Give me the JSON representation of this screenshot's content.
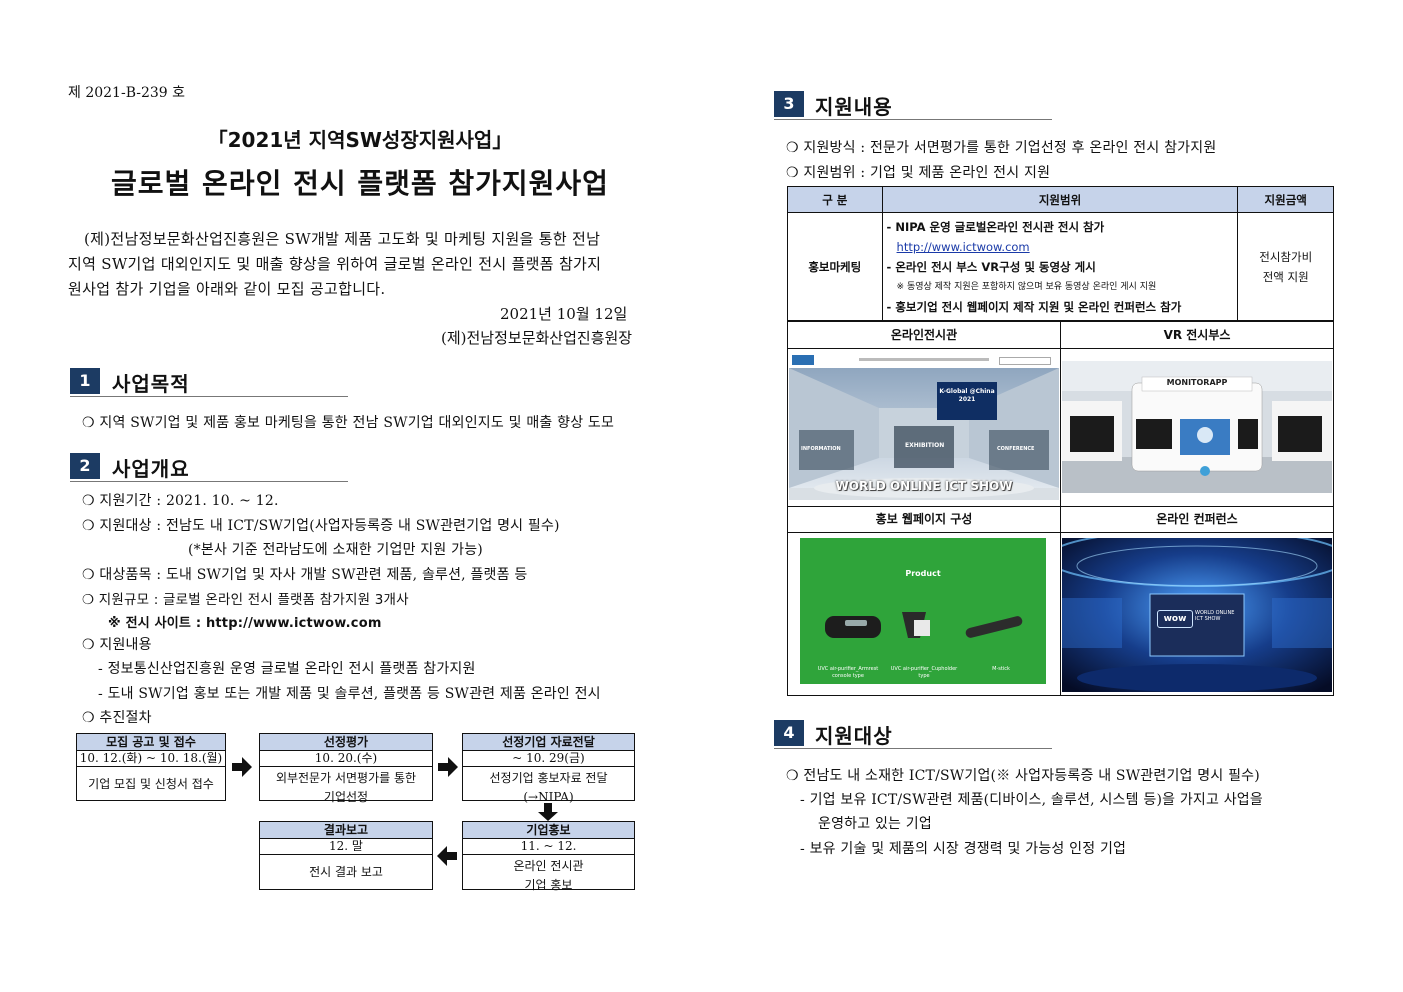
{
  "doc_number": "제  2021-B-239 호",
  "title_line1": "「2021년 지역SW성장지원사업」",
  "title_line2": "글로벌 온라인 전시 플랫폼 참가지원사업",
  "intro": [
    "(제)전남정보문화산업진흥원은 SW개발 제품 고도화 및 마케팅 지원을 통한 전남",
    "지역 SW기업 대외인지도 및 매출 향상을 위하여 글로벌 온라인 전시 플랫폼 참가지",
    "원사업 참가 기업을 아래와 같이 모집 공고합니다."
  ],
  "date": "2021년  10월  12일",
  "issuer": "(제)전남정보문화산업진흥원장",
  "sections": {
    "s1": {
      "num": "1",
      "title": "사업목적",
      "items": [
        "❍ 지역 SW기업 및 제품 홍보 마케팅을 통한 전남 SW기업 대외인지도 및 매출 향상 도모"
      ]
    },
    "s2": {
      "num": "2",
      "title": "사업개요",
      "items": [
        "❍ 지원기간 : 2021. 10. ~ 12.",
        "❍ 지원대상 : 전남도 내 ICT/SW기업(사업자등록증 내 SW관련기업 명시 필수)",
        "(*본사 기준 전라남도에 소재한 기업만 지원 가능)",
        "❍ 대상품목 : 도내 SW기업 및 자사 개발 SW관련 제품, 솔루션, 플랫폼 등",
        "❍ 지원규모 : 글로벌 온라인 전시 플랫폼 참가지원 3개사",
        "※ 전시 사이트 : http://www.ictwow.com",
        "❍ 지원내용",
        "- 정보통신산업진흥원 운영 글로벌 온라인 전시 플랫폼 참가지원",
        "- 도내 SW기업 홍보 또는 개발 제품 및 솔루션, 플랫폼 등 SW관련 제품 온라인 전시",
        "❍ 추진절차"
      ]
    },
    "s3": {
      "num": "3",
      "title": "지원내용",
      "items": [
        "❍ 지원방식 : 전문가 서면평가를 통한 기업선정 후 온라인 전시 참가지원",
        "❍ 지원범위 : 기업 및 제품 온라인 전시 지원"
      ]
    },
    "s4": {
      "num": "4",
      "title": "지원대상",
      "items": [
        "❍ 전남도 내 소재한 ICT/SW기업(※ 사업자등록증 내 SW관련기업 명시 필수)",
        "- 기업 보유 ICT/SW관련 제품(디바이스, 솔루션, 시스템 등)을 가지고 사업을",
        "운영하고 있는 기업",
        "- 보유 기술 및 제품의 시장 경쟁력 및 가능성 인정 기업"
      ]
    }
  },
  "flow": [
    {
      "head": "모집 공고 및 접수",
      "date": "10. 12.(화) ~ 10. 18.(월)",
      "body": [
        "기업 모집 및 신청서 접수"
      ]
    },
    {
      "head": "선정평가",
      "date": "10. 20.(수)",
      "body": [
        "외부전문가 서면평가를 통한",
        "기업선정"
      ]
    },
    {
      "head": "선정기업 자료전달",
      "date": "~ 10. 29(금)",
      "body": [
        "선정기업 홍보자료 전달",
        "(→NIPA)"
      ]
    },
    {
      "head": "기업홍보",
      "date": "11. ~ 12.",
      "body": [
        "온라인 전시관",
        "기업 홍보"
      ]
    },
    {
      "head": "결과보고",
      "date": "12. 말",
      "body": [
        "전시 결과 보고"
      ]
    }
  ],
  "table": {
    "headers": [
      "구  분",
      "지원범위",
      "지원금액"
    ],
    "row_label": "홍보마케팅",
    "scope": [
      "- NIPA 운영 글로벌온라인 전시관 전시 참가",
      "http://www.ictwow.com",
      "- 온라인 전시 부스 VR구성 및 동영상 게시",
      "※ 동영상 제작 지원은 포함하지 않으며 보유 동영상 온라인 게시 지원",
      "- 홍보기업 전시 웹페이지 제작 지원 및 온라인 컨퍼런스 참가"
    ],
    "amount": [
      "전시참가비",
      "전액 지원"
    ],
    "img_headers": [
      "온라인전시관",
      "VR 전시부스",
      "홍보 웹페이지 구성",
      "온라인 컨퍼런스"
    ],
    "img1": {
      "show": "WORLD ONLINE ICT SHOW",
      "screen": "K-Global @China 2021",
      "signs": [
        "INFORMATION",
        "EXHIBITION",
        "CONFERENCE"
      ]
    },
    "img2": {
      "brand": "MONITORAPP"
    },
    "img3": {
      "title": "Product",
      "items": [
        "UVC air-purifier_Armrest console type",
        "UVC air-purifier_Cupholder type",
        "M-stick"
      ]
    },
    "img4": {
      "logo": "wow",
      "text": "WORLD ONLINE ICT SHOW"
    }
  },
  "colors": {
    "section_badge": "#1c3b63",
    "table_header": "#c6d3ea",
    "green": "#2fa43a"
  }
}
